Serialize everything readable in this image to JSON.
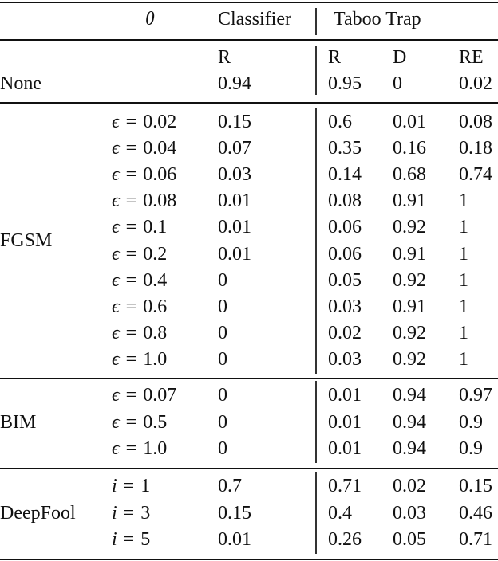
{
  "table": {
    "header": {
      "theta": "θ",
      "classifier": "Classifier",
      "taboo_trap": "Taboo Trap"
    },
    "subheader": {
      "classifier_R": "R",
      "taboo_R": "R",
      "taboo_D": "D",
      "taboo_RE": "RE"
    },
    "groups": [
      {
        "attack": "None",
        "rows": [
          {
            "param_var": "",
            "param_eq": "",
            "param_val": "",
            "classifier_R": "0.94",
            "taboo_R": "0.95",
            "taboo_D": "0",
            "taboo_RE": "0.02"
          }
        ]
      },
      {
        "attack": "FGSM",
        "rows": [
          {
            "param_var": "ϵ",
            "param_eq": "=",
            "param_val": "0.02",
            "classifier_R": "0.15",
            "taboo_R": "0.6",
            "taboo_D": "0.01",
            "taboo_RE": "0.08"
          },
          {
            "param_var": "ϵ",
            "param_eq": "=",
            "param_val": "0.04",
            "classifier_R": "0.07",
            "taboo_R": "0.35",
            "taboo_D": "0.16",
            "taboo_RE": "0.18"
          },
          {
            "param_var": "ϵ",
            "param_eq": "=",
            "param_val": "0.06",
            "classifier_R": "0.03",
            "taboo_R": "0.14",
            "taboo_D": "0.68",
            "taboo_RE": "0.74"
          },
          {
            "param_var": "ϵ",
            "param_eq": "=",
            "param_val": "0.08",
            "classifier_R": "0.01",
            "taboo_R": "0.08",
            "taboo_D": "0.91",
            "taboo_RE": "1"
          },
          {
            "param_var": "ϵ",
            "param_eq": "=",
            "param_val": "0.1",
            "classifier_R": "0.01",
            "taboo_R": "0.06",
            "taboo_D": "0.92",
            "taboo_RE": "1"
          },
          {
            "param_var": "ϵ",
            "param_eq": "=",
            "param_val": "0.2",
            "classifier_R": "0.01",
            "taboo_R": "0.06",
            "taboo_D": "0.91",
            "taboo_RE": "1"
          },
          {
            "param_var": "ϵ",
            "param_eq": "=",
            "param_val": "0.4",
            "classifier_R": "0",
            "taboo_R": "0.05",
            "taboo_D": "0.92",
            "taboo_RE": "1"
          },
          {
            "param_var": "ϵ",
            "param_eq": "=",
            "param_val": "0.6",
            "classifier_R": "0",
            "taboo_R": "0.03",
            "taboo_D": "0.91",
            "taboo_RE": "1"
          },
          {
            "param_var": "ϵ",
            "param_eq": "=",
            "param_val": "0.8",
            "classifier_R": "0",
            "taboo_R": "0.02",
            "taboo_D": "0.92",
            "taboo_RE": "1"
          },
          {
            "param_var": "ϵ",
            "param_eq": "=",
            "param_val": "1.0",
            "classifier_R": "0",
            "taboo_R": "0.03",
            "taboo_D": "0.92",
            "taboo_RE": "1"
          }
        ]
      },
      {
        "attack": "BIM",
        "rows": [
          {
            "param_var": "ϵ",
            "param_eq": "=",
            "param_val": "0.07",
            "classifier_R": "0",
            "taboo_R": "0.01",
            "taboo_D": "0.94",
            "taboo_RE": "0.97"
          },
          {
            "param_var": "ϵ",
            "param_eq": "=",
            "param_val": "0.5",
            "classifier_R": "0",
            "taboo_R": "0.01",
            "taboo_D": "0.94",
            "taboo_RE": "0.9"
          },
          {
            "param_var": "ϵ",
            "param_eq": "=",
            "param_val": "1.0",
            "classifier_R": "0",
            "taboo_R": "0.01",
            "taboo_D": "0.94",
            "taboo_RE": "0.9"
          }
        ]
      },
      {
        "attack": "DeepFool",
        "rows": [
          {
            "param_var": "i",
            "param_eq": "=",
            "param_val": "1",
            "classifier_R": "0.7",
            "taboo_R": "0.71",
            "taboo_D": "0.02",
            "taboo_RE": "0.15"
          },
          {
            "param_var": "i",
            "param_eq": "=",
            "param_val": "3",
            "classifier_R": "0.15",
            "taboo_R": "0.4",
            "taboo_D": "0.03",
            "taboo_RE": "0.46"
          },
          {
            "param_var": "i",
            "param_eq": "=",
            "param_val": "5",
            "classifier_R": "0.01",
            "taboo_R": "0.26",
            "taboo_D": "0.05",
            "taboo_RE": "0.71"
          }
        ]
      }
    ]
  }
}
